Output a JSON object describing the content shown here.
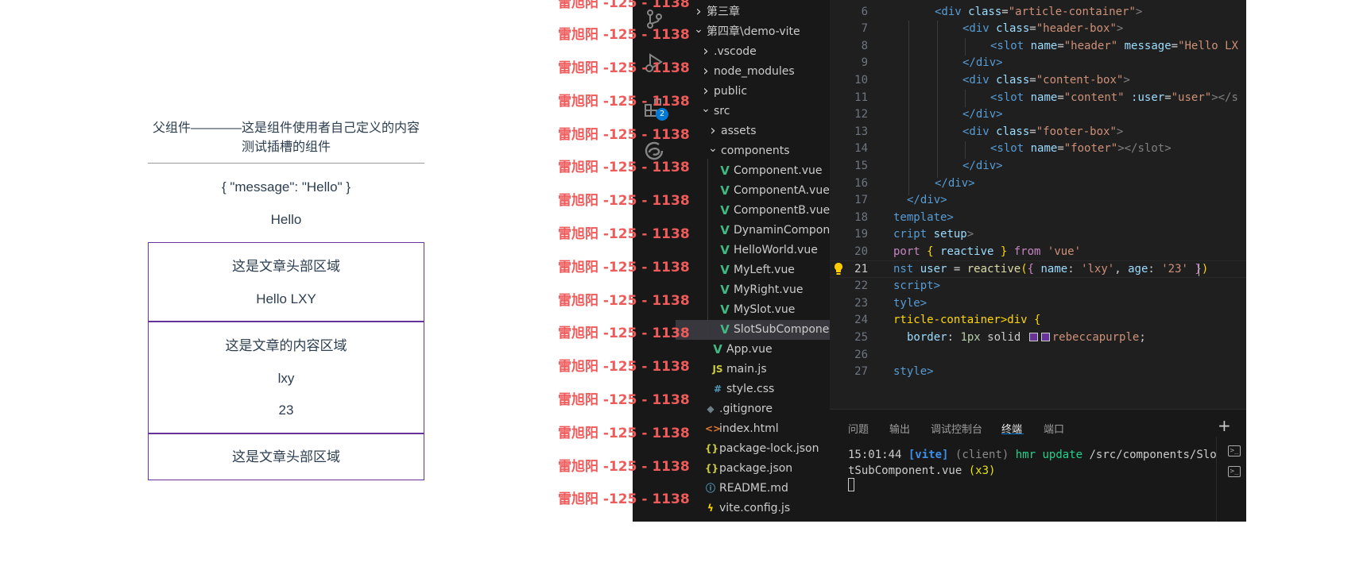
{
  "preview": {
    "heading_line1": "父组件————这是组件使用者自己定义的内容",
    "heading_line2": "测试插槽的组件",
    "message_json": "{ \"message\": \"Hello\" }",
    "message_text": "Hello",
    "header_box": {
      "title": "这是文章头部区域",
      "message": "Hello LXY"
    },
    "content_box": {
      "title": "这是文章的内容区域",
      "name": "lxy",
      "age": "23"
    },
    "footer_box": {
      "title": "这是文章头部区域"
    },
    "border_color": "#663399"
  },
  "watermark": {
    "text": "雷旭阳 -125 - 1138",
    "color": "#ef5b5b"
  },
  "activity_bar": {
    "icons": [
      "source-control-icon",
      "run-debug-icon",
      "extensions-icon",
      "edge-browser-icon"
    ],
    "extensions_badge": "2"
  },
  "explorer": {
    "items": [
      {
        "label": "第三章",
        "kind": "folder-closed"
      },
      {
        "label": "第四章\\demo-vite",
        "kind": "folder-open"
      },
      {
        "label": ".vscode",
        "kind": "folder-closed"
      },
      {
        "label": "node_modules",
        "kind": "folder-closed"
      },
      {
        "label": "public",
        "kind": "folder-closed"
      },
      {
        "label": "src",
        "kind": "folder-open"
      },
      {
        "label": "assets",
        "kind": "folder-closed"
      },
      {
        "label": "components",
        "kind": "folder-open"
      },
      {
        "label": "Component.vue",
        "kind": "vue"
      },
      {
        "label": "ComponentA.vue",
        "kind": "vue"
      },
      {
        "label": "ComponentB.vue",
        "kind": "vue"
      },
      {
        "label": "DynaminCompon...",
        "kind": "vue"
      },
      {
        "label": "HelloWorld.vue",
        "kind": "vue"
      },
      {
        "label": "MyLeft.vue",
        "kind": "vue"
      },
      {
        "label": "MyRight.vue",
        "kind": "vue"
      },
      {
        "label": "MySlot.vue",
        "kind": "vue"
      },
      {
        "label": "SlotSubCompone...",
        "kind": "vue",
        "selected": true
      },
      {
        "label": "App.vue",
        "kind": "vue"
      },
      {
        "label": "main.js",
        "kind": "js"
      },
      {
        "label": "style.css",
        "kind": "css"
      },
      {
        "label": ".gitignore",
        "kind": "git"
      },
      {
        "label": "index.html",
        "kind": "html"
      },
      {
        "label": "package-lock.json",
        "kind": "json"
      },
      {
        "label": "package.json",
        "kind": "json"
      },
      {
        "label": "README.md",
        "kind": "info"
      },
      {
        "label": "vite.config.js",
        "kind": "vite"
      }
    ]
  },
  "editor": {
    "line_numbers": [
      "6",
      "7",
      "8",
      "9",
      "10",
      "11",
      "12",
      "13",
      "14",
      "15",
      "16",
      "17",
      "18",
      "19",
      "20",
      "21",
      "22",
      "23",
      "24",
      "25",
      "26",
      "27"
    ],
    "current_line": "21",
    "code": {
      "l6": [
        "<div",
        " class",
        "=",
        "\"article-container\"",
        ">"
      ],
      "l7": [
        "<div",
        " class",
        "=",
        "\"header-box\"",
        ">"
      ],
      "l8": [
        "<slot",
        " name",
        "=",
        "\"header\"",
        " message",
        "=",
        "\"Hello LX"
      ],
      "l9": [
        "</div>"
      ],
      "l10": [
        "<div",
        " class",
        "=",
        "\"content-box\"",
        ">"
      ],
      "l11": [
        "<slot",
        " name",
        "=",
        "\"content\"",
        " :user",
        "=",
        "\"user\"",
        "></s"
      ],
      "l12": [
        "</div>"
      ],
      "l13": [
        "<div",
        " class",
        "=",
        "\"footer-box\"",
        ">"
      ],
      "l14": [
        "<slot",
        " name",
        "=",
        "\"footer\"",
        "></slot>"
      ],
      "l15": [
        "</div>"
      ],
      "l16": [
        "</div>"
      ],
      "l17": [
        "</div>"
      ],
      "l18": [
        "template>"
      ],
      "l19": [
        "cript",
        " setup",
        ">"
      ],
      "l20": [
        "port",
        " { ",
        "reactive",
        " } ",
        "from",
        " 'vue'"
      ],
      "l21": [
        "nst",
        " user",
        " = ",
        "reactive",
        "(",
        "{",
        " name",
        ": ",
        "'lxy'",
        ", ",
        "age",
        ": ",
        "'23'",
        " ",
        "}",
        ")"
      ],
      "l22": [
        "script>"
      ],
      "l23": [
        "tyle>"
      ],
      "l24": [
        "rticle-container>div {"
      ],
      "l25": [
        "border",
        ": ",
        "1px",
        " solid ",
        "rebeccapurple",
        ";"
      ],
      "l26": [
        ""
      ],
      "l27": [
        "style>"
      ]
    },
    "swatch_color": "#663399"
  },
  "panel": {
    "tabs": [
      "问题",
      "输出",
      "调试控制台",
      "终端",
      "端口"
    ],
    "active_tab": "终端",
    "terminal": {
      "time": "15:01:44",
      "tag": "[vite]",
      "client": "(client)",
      "action": "hmr update",
      "path_part1": "/src/components/Slo",
      "path_part2": "tSubComponent.vue",
      "count": "(x3)"
    }
  }
}
